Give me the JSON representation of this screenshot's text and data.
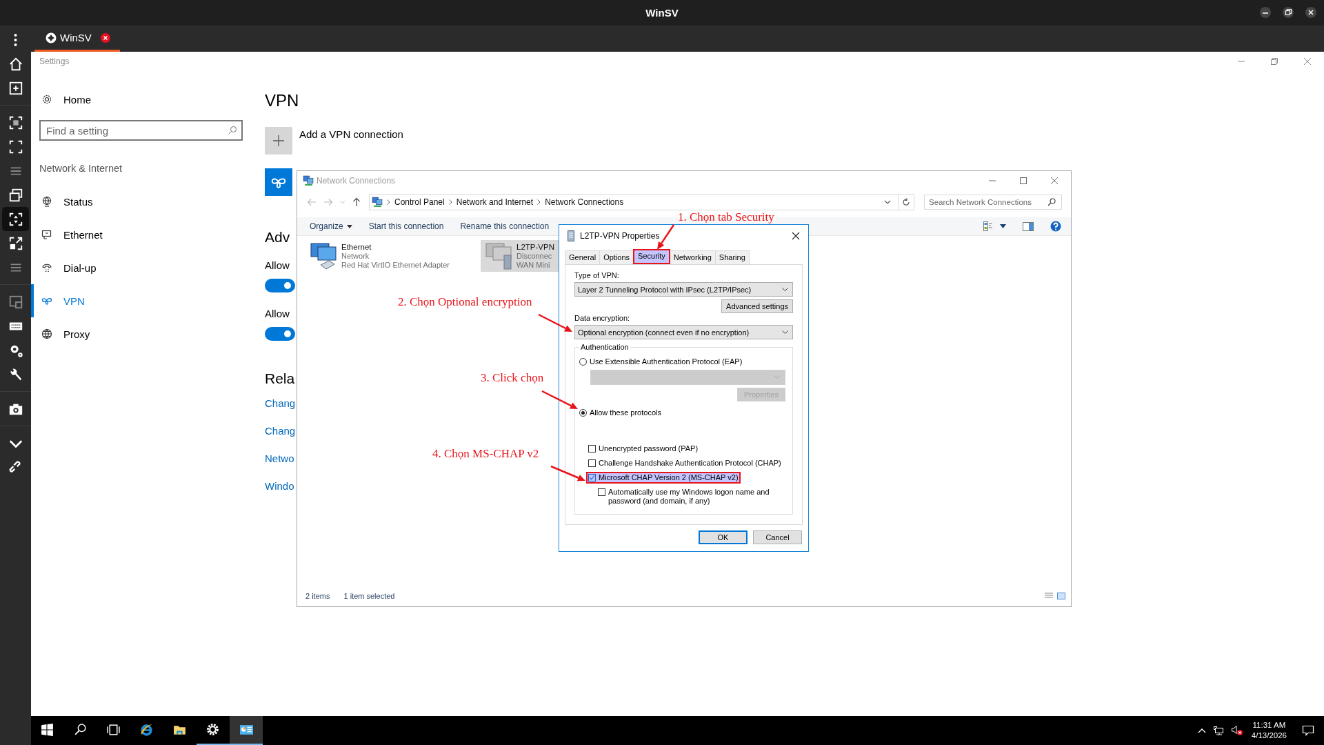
{
  "window": {
    "title": "WinSV"
  },
  "tabs": [
    {
      "label": "WinSV",
      "selected": true
    }
  ],
  "rail": {
    "groups": [
      {
        "items": [
          {
            "kind": "menu",
            "selected": false
          },
          {
            "kind": "home",
            "selected": false
          },
          {
            "kind": "add-window",
            "selected": false
          }
        ]
      },
      {
        "items": [
          {
            "kind": "focus",
            "selected": false
          },
          {
            "kind": "fullscreen",
            "selected": false
          },
          {
            "kind": "list",
            "selected": false
          },
          {
            "kind": "windows",
            "selected": false
          },
          {
            "kind": "fit",
            "selected": true
          },
          {
            "kind": "expand",
            "selected": false
          },
          {
            "kind": "list",
            "selected": false
          }
        ]
      },
      {
        "items": [
          {
            "kind": "monitor",
            "selected": false
          },
          {
            "kind": "keyboard",
            "selected": false
          },
          {
            "kind": "gears",
            "selected": false
          },
          {
            "kind": "wrench",
            "selected": false
          }
        ]
      },
      {
        "items": [
          {
            "kind": "camera",
            "selected": false
          }
        ]
      },
      {
        "items": [
          {
            "kind": "chevron",
            "selected": false
          },
          {
            "kind": "link",
            "selected": false
          }
        ]
      }
    ]
  },
  "settings": {
    "title": "Settings",
    "home": "Home",
    "search": {
      "placeholder": "Find a setting"
    },
    "section": "Network & Internet",
    "nav": [
      {
        "kind": "status",
        "label": "Status",
        "selected": false
      },
      {
        "kind": "ethernet",
        "label": "Ethernet",
        "selected": false
      },
      {
        "kind": "dialup",
        "label": "Dial-up",
        "selected": false
      },
      {
        "kind": "vpn",
        "label": "VPN",
        "selected": true
      },
      {
        "kind": "proxy",
        "label": "Proxy",
        "selected": false
      }
    ],
    "heading": "VPN",
    "add_label": "Add a VPN connection",
    "advanced_heading": "Adv",
    "toggles": [
      {
        "label": "Allow",
        "on": true
      },
      {
        "label": "Allow",
        "on": true
      }
    ],
    "related_heading": "Rela",
    "links": [
      "Chang",
      "Chang",
      "Netwo",
      "Windo"
    ]
  },
  "explorer": {
    "title": "Network Connections",
    "breadcrumb": [
      "Control Panel",
      "Network and Internet",
      "Network Connections"
    ],
    "search": {
      "placeholder": "Search Network Connections"
    },
    "toolbar": [
      {
        "kind": "menu",
        "label": "Organize"
      },
      {
        "kind": "command",
        "label": "Start this connection"
      },
      {
        "kind": "command",
        "label": "Rename this connection"
      }
    ],
    "items": [
      {
        "name": "Ethernet",
        "lines": [
          "Network",
          "Red Hat VirtIO Ethernet Adapter"
        ],
        "selected": false
      },
      {
        "name": "L2TP-VPN",
        "lines": [
          "Disconnec",
          "WAN Mini"
        ],
        "selected": true
      }
    ],
    "status": [
      "2 items",
      "1 item selected"
    ]
  },
  "dialog": {
    "title": "L2TP-VPN Properties",
    "tabs": [
      {
        "label": "General",
        "selected": false,
        "highlighted": false
      },
      {
        "label": "Options",
        "selected": false,
        "highlighted": false
      },
      {
        "label": "Security",
        "selected": true,
        "highlighted": true
      },
      {
        "label": "Networking",
        "selected": false,
        "highlighted": false
      },
      {
        "label": "Sharing",
        "selected": false,
        "highlighted": false
      }
    ],
    "vpn_type_label": "Type of VPN:",
    "vpn_type": "Layer 2 Tunneling Protocol with IPsec (L2TP/IPsec)",
    "advanced_button": "Advanced settings",
    "encryption_label": "Data encryption:",
    "encryption": "Optional encryption (connect even if no encryption)",
    "auth_group": "Authentication",
    "auth_options": [
      {
        "label": "Use Extensible Authentication Protocol (EAP)",
        "selected": false
      },
      {
        "label": "Allow these protocols",
        "selected": true
      }
    ],
    "eap_properties": {
      "label": "Properties",
      "disabled": true
    },
    "protocols": [
      {
        "label": "Unencrypted password (PAP)",
        "checked": false,
        "highlighted": false
      },
      {
        "label": "Challenge Handshake Authentication Protocol (CHAP)",
        "checked": false,
        "highlighted": false
      },
      {
        "label": "Microsoft CHAP Version 2 (MS-CHAP v2)",
        "checked": true,
        "highlighted": true,
        "children": [
          {
            "label": "Automatically use my Windows logon name and password (and domain, if any)",
            "checked": false,
            "highlighted": false
          }
        ]
      }
    ],
    "buttons": [
      {
        "label": "OK",
        "default": true
      },
      {
        "label": "Cancel",
        "default": false
      }
    ]
  },
  "annotations": [
    {
      "text": "1. Chọn tab Security"
    },
    {
      "text": "2. Chọn Optional encryption"
    },
    {
      "text": "3. Click chọn"
    },
    {
      "text": "4. Chọn MS-CHAP v2"
    }
  ],
  "taskbar": {
    "apps": [
      {
        "kind": "start",
        "running": false,
        "selected": false
      },
      {
        "kind": "search",
        "running": false,
        "selected": false
      },
      {
        "kind": "taskview",
        "running": false,
        "selected": false
      },
      {
        "kind": "browser",
        "running": false,
        "selected": false
      },
      {
        "kind": "folder",
        "running": false,
        "selected": false
      },
      {
        "kind": "settings",
        "running": true,
        "selected": false
      },
      {
        "kind": "control",
        "running": true,
        "selected": true
      }
    ],
    "time": "11:31 AM",
    "date": "4/13/2026"
  }
}
